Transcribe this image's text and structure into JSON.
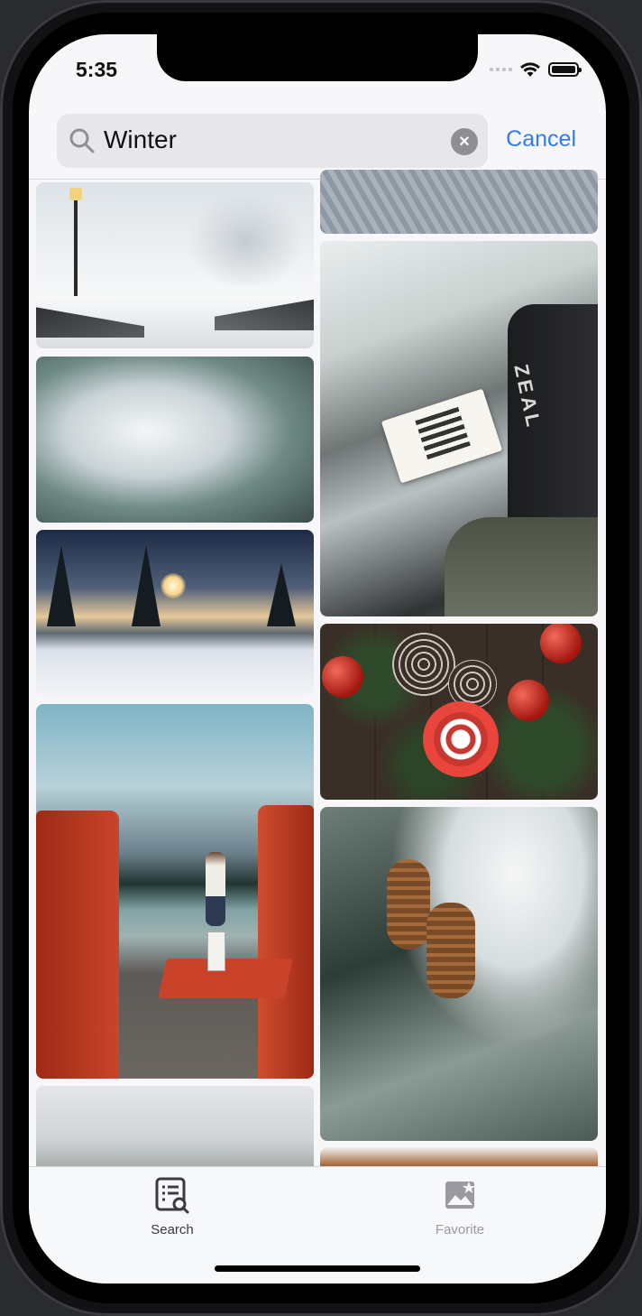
{
  "status_bar": {
    "time": "5:35"
  },
  "search": {
    "query": "Winter",
    "cancel_label": "Cancel"
  },
  "tabs": [
    {
      "label": "Search",
      "icon": "search-list-icon",
      "active": true
    },
    {
      "label": "Favorite",
      "icon": "photo-star-icon",
      "active": false
    }
  ],
  "colors": {
    "accent": "#2f7cf6",
    "active_tab": "#3b3b3f",
    "inactive_tab": "#9a9aa0"
  }
}
